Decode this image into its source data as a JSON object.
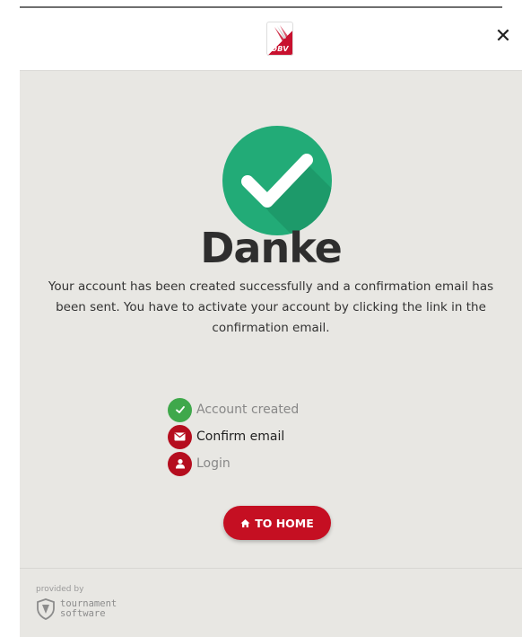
{
  "header": {
    "logo_text": "ÖBV",
    "close_label": "✕"
  },
  "main": {
    "title": "Danke",
    "message": "Your account has been created successfully and a confirmation email has been sent. You have to activate your account by clicking the link in the confirmation email.",
    "steps": [
      {
        "label": "Account created",
        "icon": "check-icon",
        "status": "done"
      },
      {
        "label": "Confirm email",
        "icon": "envelope-icon",
        "status": "active"
      },
      {
        "label": "Login",
        "icon": "user-icon",
        "status": "pending"
      }
    ],
    "home_button_label": "TO HOME"
  },
  "footer": {
    "provided_by": "provided by",
    "brand_line1": "tournament",
    "brand_line2": "software"
  },
  "colors": {
    "success_green": "#22ab77",
    "step_green": "#3fa84b",
    "brand_red": "#c50f22",
    "body_bg": "#e8e7e3"
  }
}
